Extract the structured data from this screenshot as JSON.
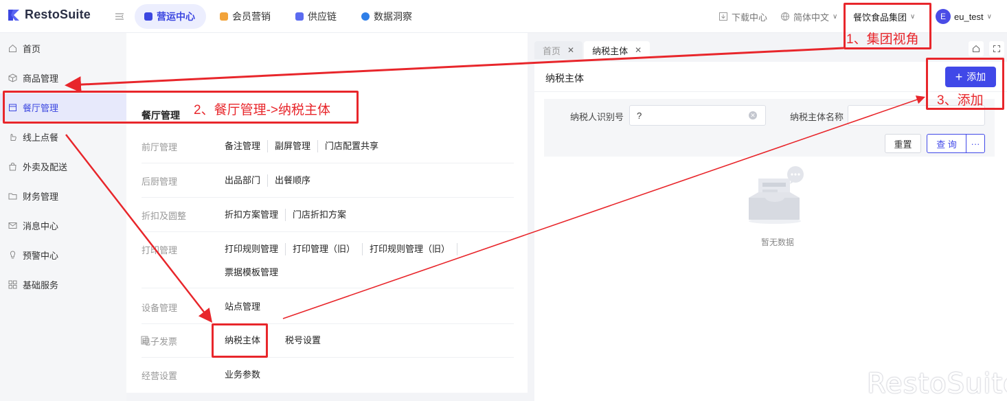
{
  "app": {
    "name": "RestoSuite",
    "brand_color": "#3b46e0"
  },
  "top_nav": [
    {
      "label": "营运中心",
      "color": "#3b46e0",
      "active": true
    },
    {
      "label": "会员营销",
      "color": "#f2a33a",
      "active": false
    },
    {
      "label": "供应链",
      "color": "#5b6bf0",
      "active": false
    },
    {
      "label": "数据洞察",
      "color": "#2f7fe8",
      "active": false
    }
  ],
  "top_right": {
    "download": "下载中心",
    "language": "简体中文",
    "org": "餐饮食品集团",
    "avatar_initial": "E",
    "user": "eu_test"
  },
  "sidebar": [
    {
      "label": "首页",
      "icon": "home-icon"
    },
    {
      "label": "商品管理",
      "icon": "box-icon"
    },
    {
      "label": "餐厅管理",
      "icon": "store-icon",
      "active": true
    },
    {
      "label": "线上点餐",
      "icon": "hand-icon"
    },
    {
      "label": "外卖及配送",
      "icon": "bag-icon"
    },
    {
      "label": "财务管理",
      "icon": "folder-icon"
    },
    {
      "label": "消息中心",
      "icon": "mail-icon"
    },
    {
      "label": "预警中心",
      "icon": "bulb-icon"
    },
    {
      "label": "基础服务",
      "icon": "grid-icon"
    }
  ],
  "mega_menu": {
    "title": "餐厅管理",
    "rows": [
      {
        "category": "前厅管理",
        "links": [
          "备注管理",
          "副屏管理",
          "门店配置共享"
        ]
      },
      {
        "category": "后厨管理",
        "links": [
          "出品部门",
          "出餐顺序"
        ]
      },
      {
        "category": "折扣及圆整",
        "links": [
          "折扣方案管理",
          "门店折扣方案"
        ]
      },
      {
        "category": "打印管理",
        "links": [
          "打印规则管理",
          "打印管理（旧）",
          "打印规则管理（旧）",
          "票据模板管理"
        ]
      },
      {
        "category": "设备管理",
        "links": [
          "站点管理"
        ]
      },
      {
        "category": "电子发票",
        "links": [
          "纳税主体",
          "税号设置"
        ]
      },
      {
        "category": "经营设置",
        "links": [
          "业务参数"
        ]
      }
    ]
  },
  "tabs": [
    {
      "label": "首页",
      "active": false
    },
    {
      "label": "纳税主体",
      "active": true
    }
  ],
  "panel": {
    "title": "纳税主体",
    "add_label": "添加",
    "filter": {
      "taxpayer_id_label": "纳税人识别号",
      "taxpayer_id_value": "?",
      "entity_name_label": "纳税主体名称",
      "entity_name_value": "",
      "reset_label": "重置",
      "query_label": "查 询",
      "more_label": "···"
    },
    "empty_text": "暂无数据"
  },
  "annotations": {
    "step1": "1、集团视角",
    "step2": "2、餐厅管理->纳税主体",
    "step3": "3、添加",
    "color": "#e8262b"
  },
  "watermark": "RestoSuite"
}
